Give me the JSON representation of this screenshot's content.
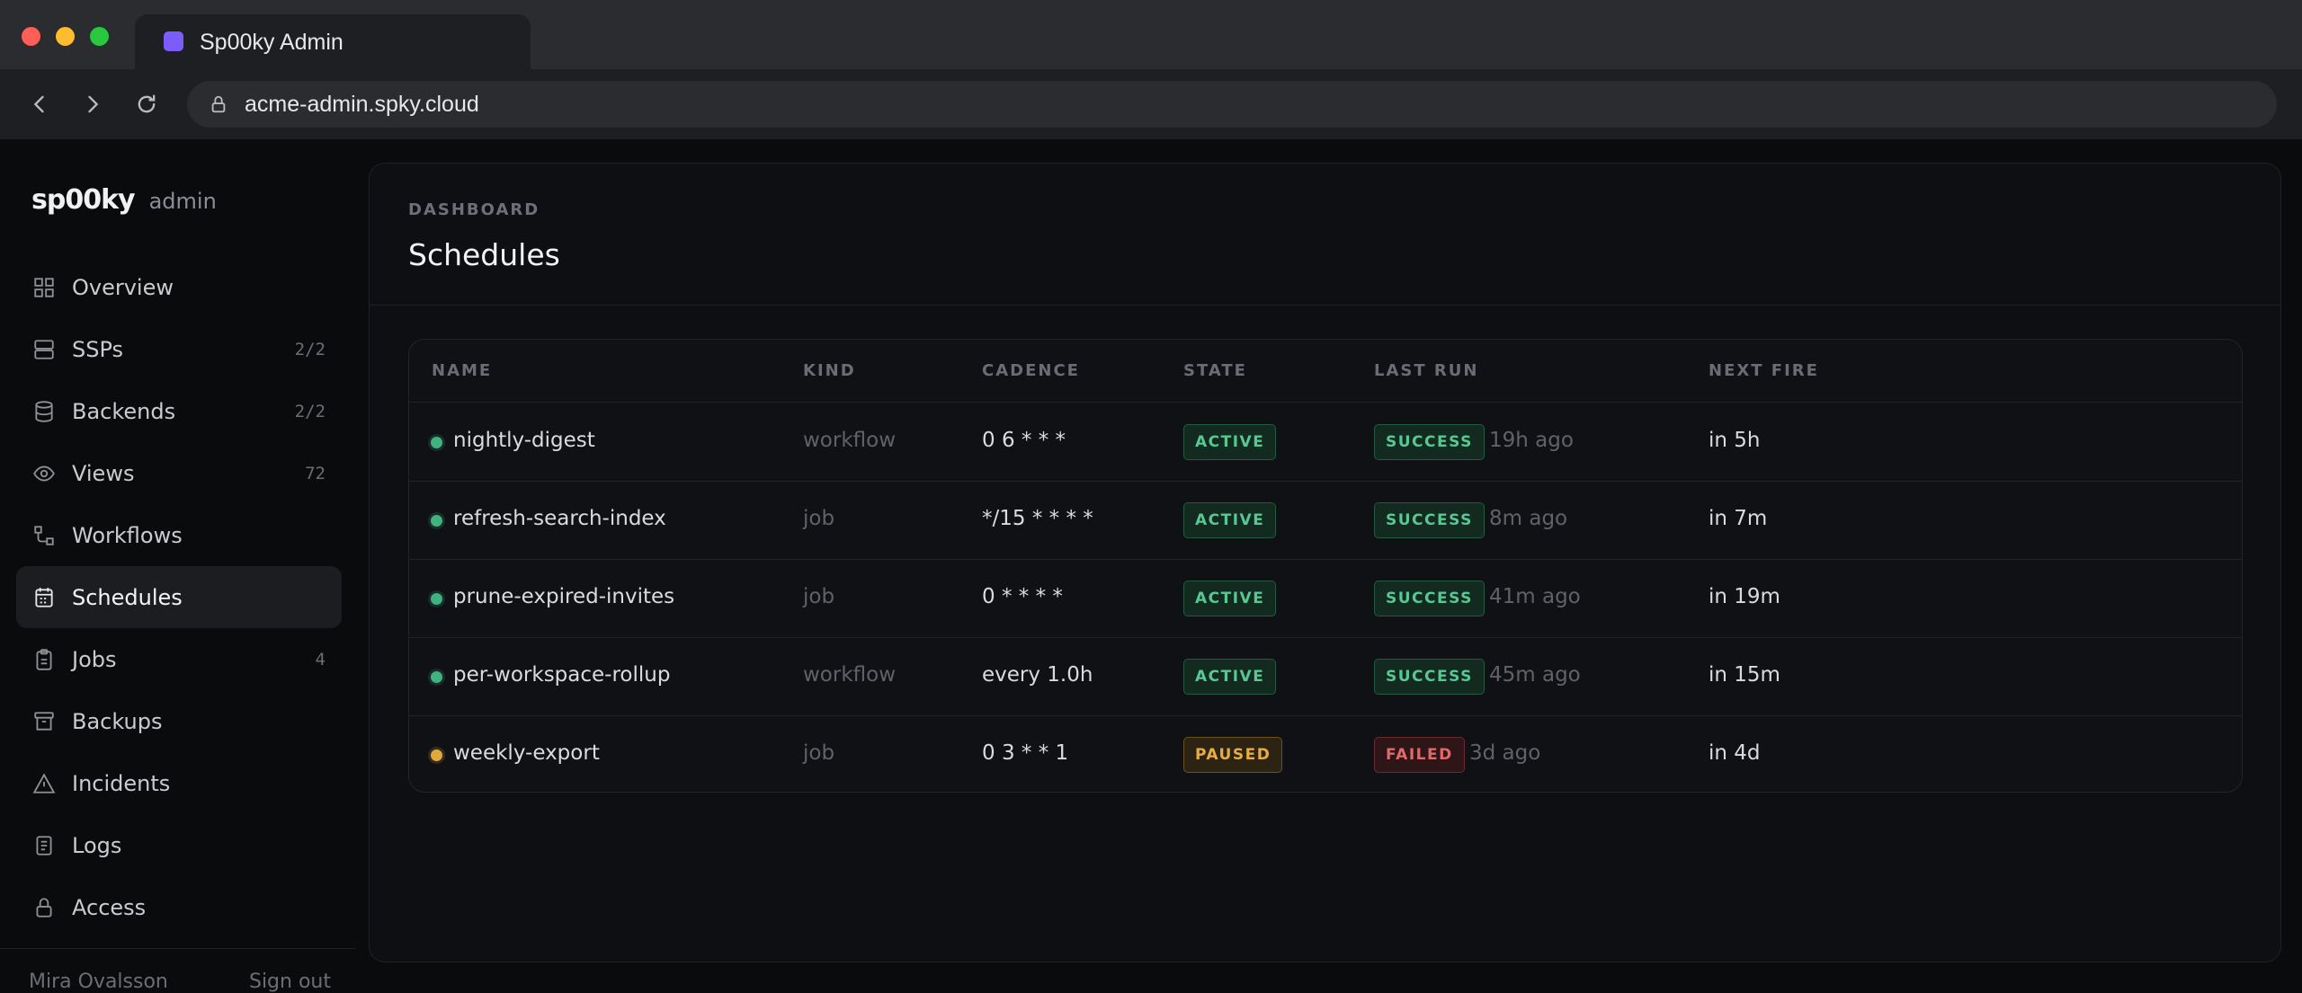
{
  "browser": {
    "tab_title": "Sp00ky Admin",
    "url": "acme-admin.spky.cloud"
  },
  "sidebar": {
    "brand": "sp00ky",
    "brand_sub": "admin",
    "items": [
      {
        "label": "Overview",
        "count": "",
        "icon": "grid-icon"
      },
      {
        "label": "SSPs",
        "count": "2/2",
        "icon": "server-icon"
      },
      {
        "label": "Backends",
        "count": "2/2",
        "icon": "database-icon"
      },
      {
        "label": "Views",
        "count": "72",
        "icon": "eye-icon"
      },
      {
        "label": "Workflows",
        "count": "",
        "icon": "workflow-icon"
      },
      {
        "label": "Schedules",
        "count": "",
        "icon": "calendar-icon"
      },
      {
        "label": "Jobs",
        "count": "4",
        "icon": "clipboard-icon"
      },
      {
        "label": "Backups",
        "count": "",
        "icon": "archive-icon"
      },
      {
        "label": "Incidents",
        "count": "",
        "icon": "warning-icon"
      },
      {
        "label": "Logs",
        "count": "",
        "icon": "document-icon"
      },
      {
        "label": "Access",
        "count": "",
        "icon": "lock-icon"
      }
    ],
    "active": "Schedules",
    "user_name": "Mira Ovalsson",
    "sign_out": "Sign out"
  },
  "page": {
    "breadcrumb": "DASHBOARD",
    "title": "Schedules"
  },
  "table": {
    "columns": [
      "NAME",
      "KIND",
      "CADENCE",
      "STATE",
      "LAST RUN",
      "NEXT FIRE"
    ],
    "rows": [
      {
        "name": "nightly-digest",
        "kind": "workflow",
        "cadence": "0 6 * * *",
        "state": "ACTIVE",
        "last_status": "SUCCESS",
        "last_ago": "19h ago",
        "next_fire": "in 5h",
        "dot": "green"
      },
      {
        "name": "refresh-search-index",
        "kind": "job",
        "cadence": "*/15 * * * *",
        "state": "ACTIVE",
        "last_status": "SUCCESS",
        "last_ago": "8m ago",
        "next_fire": "in 7m",
        "dot": "green"
      },
      {
        "name": "prune-expired-invites",
        "kind": "job",
        "cadence": "0 * * * *",
        "state": "ACTIVE",
        "last_status": "SUCCESS",
        "last_ago": "41m ago",
        "next_fire": "in 19m",
        "dot": "green"
      },
      {
        "name": "per-workspace-rollup",
        "kind": "workflow",
        "cadence": "every 1.0h",
        "state": "ACTIVE",
        "last_status": "SUCCESS",
        "last_ago": "45m ago",
        "next_fire": "in 15m",
        "dot": "green"
      },
      {
        "name": "weekly-export",
        "kind": "job",
        "cadence": "0 3 * * 1",
        "state": "PAUSED",
        "last_status": "FAILED",
        "last_ago": "3d ago",
        "next_fire": "in 4d",
        "dot": "amber"
      }
    ]
  },
  "colors": {
    "accent": "#7c5cff",
    "success": "#58c893",
    "paused": "#e6ad45",
    "failed": "#e06a6a"
  }
}
